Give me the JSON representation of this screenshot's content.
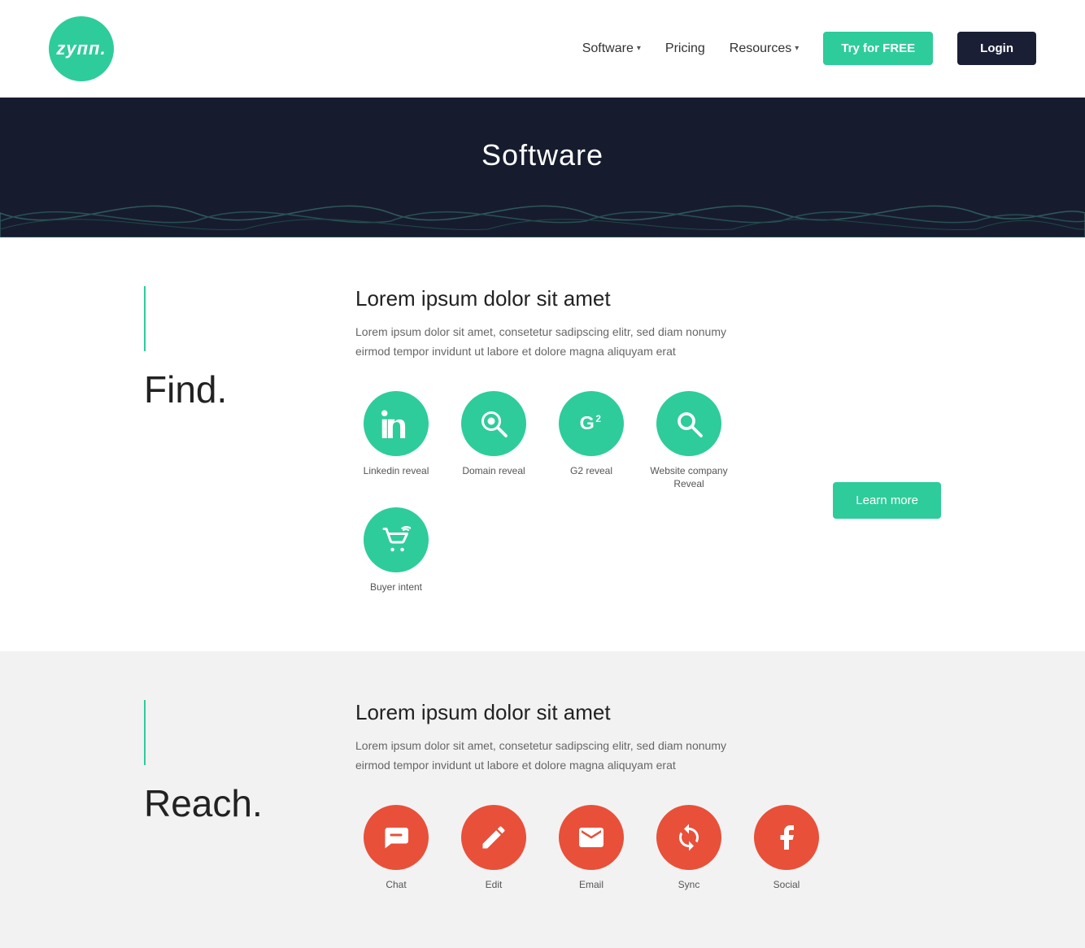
{
  "header": {
    "logo_text": "zyпп.",
    "nav": [
      {
        "label": "Software",
        "has_dropdown": true
      },
      {
        "label": "Pricing",
        "has_dropdown": false
      },
      {
        "label": "Resources",
        "has_dropdown": true
      }
    ],
    "try_label": "Try for FREE",
    "login_label": "Login"
  },
  "hero": {
    "title": "Software"
  },
  "find_section": {
    "heading": "Find.",
    "title": "Lorem ipsum dolor sit amet",
    "description": "Lorem ipsum dolor sit amet, consetetur sadipscing elitr, sed diam nonumy eirmod tempor invidunt ut labore et dolore magna aliquyam erat",
    "learn_more": "Learn more",
    "icons": [
      {
        "label": "Linkedin reveal",
        "type": "linkedin"
      },
      {
        "label": "Domain reveal",
        "type": "search-globe"
      },
      {
        "label": "G2 reveal",
        "type": "g2"
      },
      {
        "label": "Website company Reveal",
        "type": "search"
      },
      {
        "label": "Buyer intent",
        "type": "cart"
      }
    ]
  },
  "reach_section": {
    "heading": "Reach.",
    "title": "Lorem ipsum dolor sit amet",
    "description": "Lorem ipsum dolor sit amet, consetetur sadipscing elitr, sed diam nonumy eirmod tempor invidunt ut labore et dolore magna aliquyam erat",
    "icons": [
      {
        "label": "Chat",
        "type": "chat"
      },
      {
        "label": "Edit",
        "type": "edit"
      },
      {
        "label": "Email",
        "type": "email"
      },
      {
        "label": "Sync",
        "type": "sync"
      },
      {
        "label": "Social",
        "type": "social"
      }
    ]
  }
}
